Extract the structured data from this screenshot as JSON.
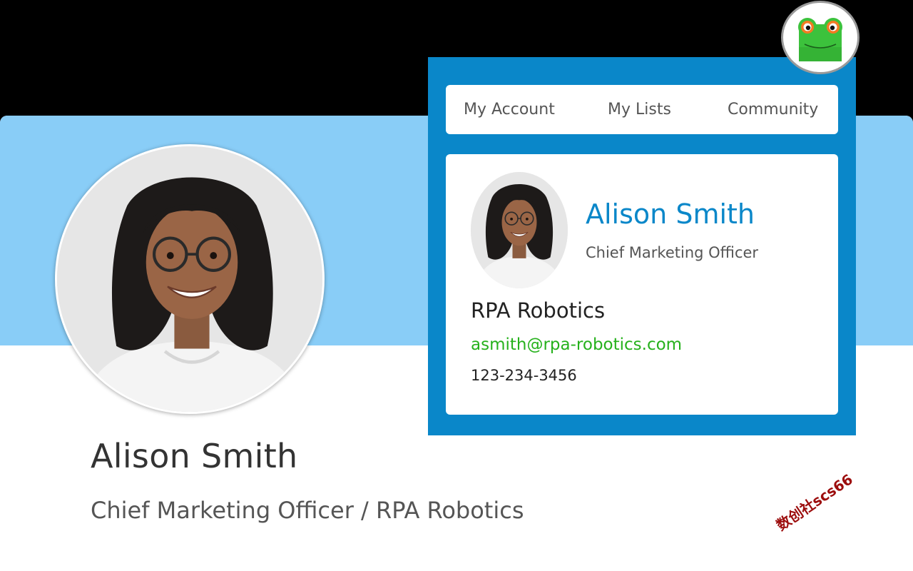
{
  "profile": {
    "name": "Alison Smith",
    "subtitle": "Chief Marketing Officer / RPA Robotics"
  },
  "nav": {
    "tabs": [
      {
        "label": "My Account"
      },
      {
        "label": "My Lists"
      },
      {
        "label": "Community"
      }
    ]
  },
  "contact_card": {
    "name": "Alison Smith",
    "title": "Chief Marketing Officer",
    "company": "RPA Robotics",
    "email": "asmith@rpa-robotics.com",
    "phone": "123-234-3456"
  },
  "watermark": "数创社scs66",
  "icons": {
    "logo": "frog-logo-icon",
    "avatar": "avatar-photo"
  },
  "colors": {
    "banner": "#89cdf7",
    "panel": "#0a87c9",
    "name_accent": "#0a87c9",
    "email": "#26b11c",
    "watermark": "#9c0d0d"
  }
}
